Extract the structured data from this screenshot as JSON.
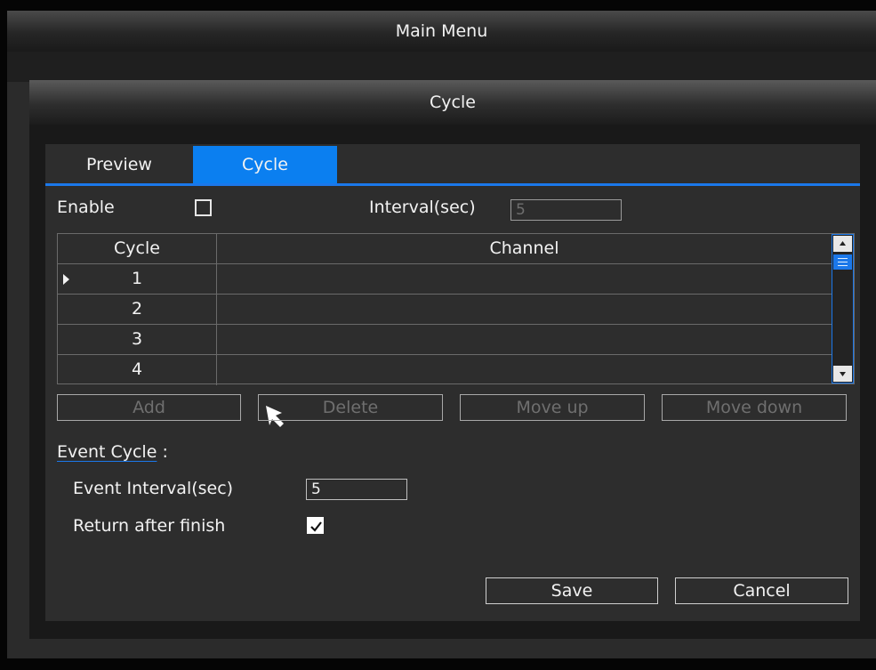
{
  "window": {
    "title": "Main Menu"
  },
  "dialog": {
    "title": "Cycle",
    "tabs": [
      {
        "label": "Preview",
        "active": false
      },
      {
        "label": "Cycle",
        "active": true
      }
    ],
    "enable": {
      "label": "Enable",
      "checked": false
    },
    "interval": {
      "label": "Interval(sec)",
      "value": "5",
      "disabled": true
    },
    "table": {
      "columns": [
        "Cycle",
        "Channel"
      ],
      "rows": [
        {
          "cycle": "1",
          "channel": "",
          "selected": true
        },
        {
          "cycle": "2",
          "channel": ""
        },
        {
          "cycle": "3",
          "channel": ""
        },
        {
          "cycle": "4",
          "channel": ""
        }
      ]
    },
    "actions": {
      "add": "Add",
      "delete": "Delete",
      "move_up": "Move up",
      "move_down": "Move down"
    },
    "event_cycle": {
      "title": "Event Cycle",
      "colon": ":",
      "interval_label": "Event Interval(sec)",
      "interval_value": "5",
      "return_label": "Return after finish",
      "return_checked": true
    },
    "footer": {
      "save": "Save",
      "cancel": "Cancel"
    }
  },
  "colors": {
    "accent": "#0b7ff0",
    "background": "#2d2d2d"
  }
}
